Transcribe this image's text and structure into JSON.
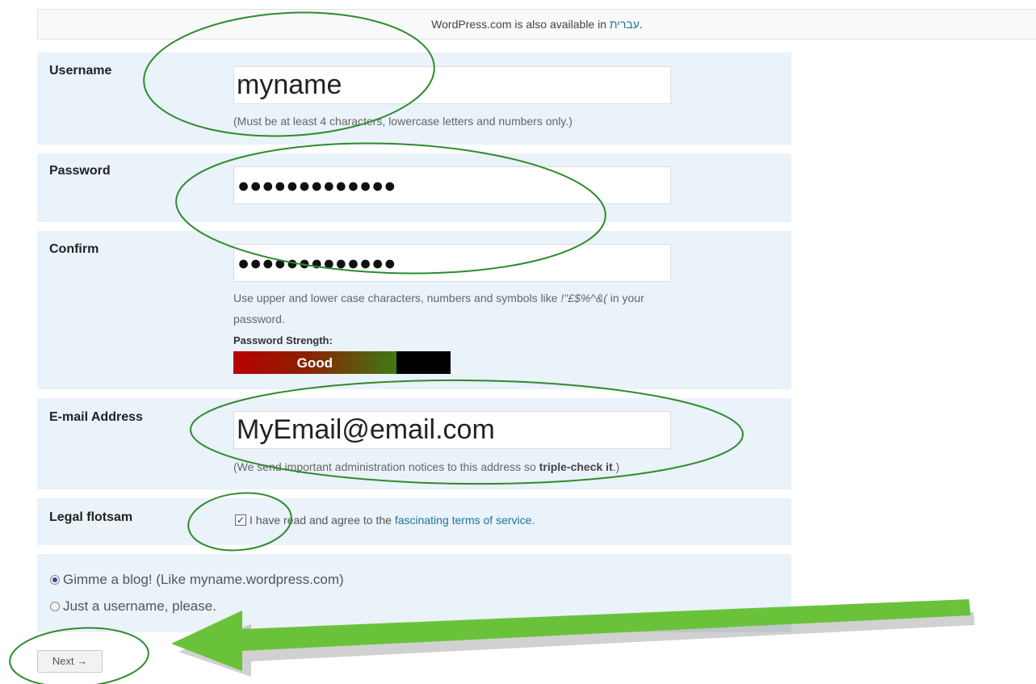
{
  "language_bar": {
    "text": "WordPress.com is also available in ",
    "link": "עברית",
    "suffix": "."
  },
  "username": {
    "label": "Username",
    "value": "myname",
    "hint": "(Must be at least 4 characters, lowercase letters and numbers only.)"
  },
  "password": {
    "label": "Password",
    "masked_value": "●●●●●●●●●●●●●"
  },
  "confirm": {
    "label": "Confirm",
    "masked_value": "●●●●●●●●●●●●●",
    "hint_line1_pre": "Use upper and lower case characters, numbers and symbols like ",
    "hint_symbols": "!\"£$%^&(",
    "hint_line1_post": " in your",
    "hint_line2": "password.",
    "strength_label": "Password Strength:",
    "strength_text": "Good",
    "strength_fraction": 0.75,
    "strength_colors": [
      "#b70000",
      "#3f7a15"
    ]
  },
  "email": {
    "label": "E-mail Address",
    "value": "MyEmail@email.com",
    "hint_pre": "(We send important administration notices to this address so ",
    "hint_bold": "triple-check it",
    "hint_post": ".)"
  },
  "legal": {
    "label": "Legal flotsam",
    "checked": true,
    "text_pre": "I have read and agree to the ",
    "link": "fascinating terms of service",
    "text_post": "."
  },
  "blog_choice": {
    "options": [
      {
        "label": "Gimme a blog! (Like myname.wordpress.com)",
        "checked": true
      },
      {
        "label": "Just a username, please.",
        "checked": false
      }
    ]
  },
  "next_button": {
    "label": "Next →"
  },
  "annotation_colors": {
    "circle": "#2e8b2e",
    "arrow": "#6ac23a"
  }
}
